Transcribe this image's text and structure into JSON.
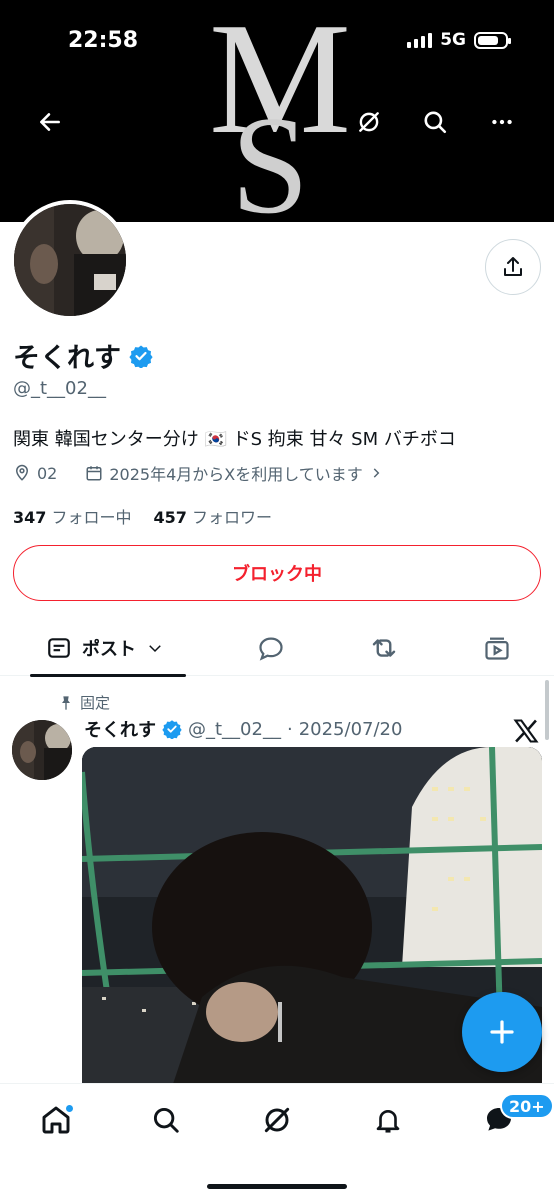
{
  "status_bar": {
    "time": "22:58",
    "network": "5G",
    "battery_level": 0.75
  },
  "banner": {
    "logo_letters": "MS"
  },
  "nav": {
    "back_icon": "back-arrow-icon",
    "grok_icon": "grok-icon",
    "search_icon": "search-icon",
    "more_icon": "more-icon"
  },
  "profile": {
    "display_name": "そくれす",
    "verified": true,
    "handle": "@_t__02__",
    "bio": "関東 韓国センター分け 🇰🇷 ドS 拘束 甘々 SM バチボコ",
    "location": "02",
    "joined": "2025年4月からXを利用しています",
    "following_count": "347",
    "following_label": "フォロー中",
    "followers_count": "457",
    "followers_label": "フォロワー",
    "block_button_label": "ブロック中"
  },
  "tabs": {
    "posts_label": "ポスト",
    "items": [
      "posts",
      "replies",
      "reposts",
      "media"
    ]
  },
  "post": {
    "pinned_label": "固定",
    "author_name": "そくれす",
    "author_handle": "@_t__02__",
    "separator": "·",
    "date": "2025/07/20"
  },
  "bottom_nav": {
    "items": [
      "home",
      "search",
      "grok",
      "notifications",
      "messages"
    ],
    "messages_badge": "20+"
  },
  "colors": {
    "accent": "#1d9bf0",
    "block_red": "#f4212e",
    "text": "#0f1419",
    "muted": "#536471"
  }
}
